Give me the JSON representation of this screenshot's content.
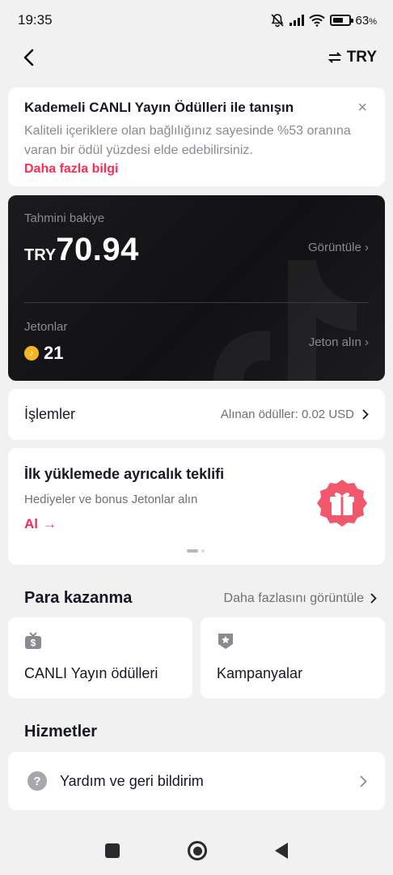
{
  "status_bar": {
    "time": "19:35",
    "battery": "63",
    "battery_unit": "%"
  },
  "header": {
    "currency_label": "TRY",
    "currency_icon": "swap-icon"
  },
  "promo": {
    "title": "Kademeli CANLI Yayın Ödülleri ile tanışın",
    "text": "Kaliteli içeriklere olan bağlılığınız sayesinde %53 oranına varan bir ödül yüzdesi elde edebilirsiniz.",
    "link": "Daha fazla bilgi",
    "close": "×"
  },
  "balance": {
    "label": "Tahmini bakiye",
    "currency": "TRY",
    "amount": "70.94",
    "view_label": "Görüntüle",
    "coins_label": "Jetonlar",
    "coins_value": "21",
    "buy_label": "Jeton alın"
  },
  "transactions": {
    "title": "İşlemler",
    "summary": "Alınan ödüller: 0.02 USD"
  },
  "offer": {
    "title": "İlk yüklemede ayrıcalık teklifi",
    "subtitle": "Hediyeler ve bonus Jetonlar alın",
    "cta": "Al",
    "cta_arrow": "→"
  },
  "monetization": {
    "title": "Para kazanma",
    "more": "Daha fazlasını görüntüle",
    "tiles": [
      {
        "label": "CANLI Yayın ödülleri",
        "icon": "live-rewards-icon"
      },
      {
        "label": "Kampanyalar",
        "icon": "campaigns-icon"
      }
    ]
  },
  "services": {
    "title": "Hizmetler",
    "items": [
      {
        "label": "Yardım ve geri bildirim",
        "icon": "help-icon"
      }
    ]
  },
  "colors": {
    "accent": "#fe2c55",
    "coin": "#f5b421",
    "background": "#f1f1f2"
  }
}
